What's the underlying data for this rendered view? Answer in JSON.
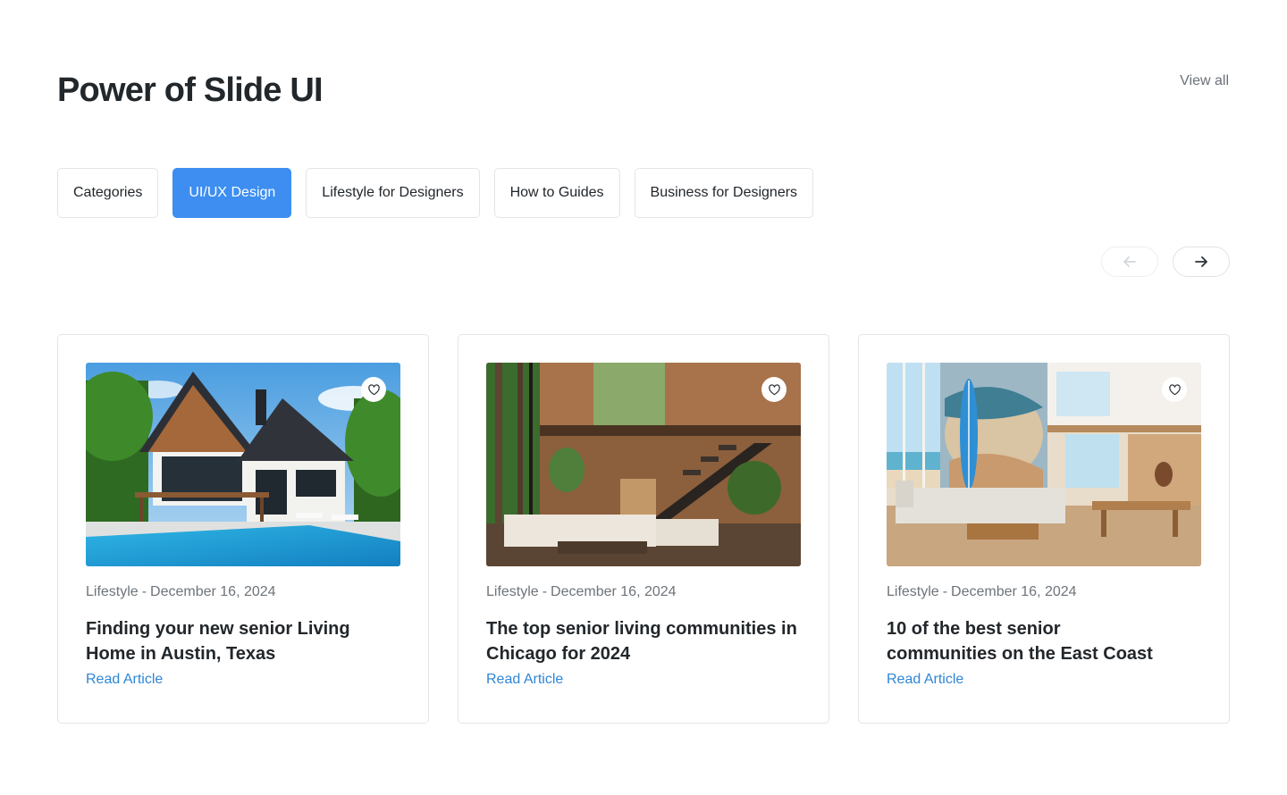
{
  "header": {
    "title": "Power of Slide UI",
    "view_all": "View all"
  },
  "tabs": [
    {
      "label": "Categories",
      "active": false
    },
    {
      "label": "UI/UX Design",
      "active": true
    },
    {
      "label": "Lifestyle for Designers",
      "active": false
    },
    {
      "label": "How to Guides",
      "active": false
    },
    {
      "label": "Business for Designers",
      "active": false
    }
  ],
  "carousel": {
    "prev_icon": "arrow-left-icon",
    "prev_disabled": true,
    "next_icon": "arrow-right-icon"
  },
  "cards": [
    {
      "image": "modern-house-with-pool",
      "category": "Lifestyle",
      "separator": "-",
      "date": "December 16, 2024",
      "title": "Finding your new senior Living Home in Austin, Texas",
      "link": "Read Article",
      "favorite_icon": "heart-icon"
    },
    {
      "image": "modern-living-room-with-staircase",
      "category": "Lifestyle",
      "separator": "-",
      "date": "December 16, 2024",
      "title": "The top senior living communities in Chicago for 2024",
      "link": "Read Article",
      "favorite_icon": "heart-icon"
    },
    {
      "image": "beach-house-living-room-with-surfboard",
      "category": "Lifestyle",
      "separator": "-",
      "date": "December 16, 2024",
      "title": "10 of the best senior communities on the East Coast",
      "link": "Read Article",
      "favorite_icon": "heart-icon"
    }
  ],
  "colors": {
    "accent": "#3d8ef0",
    "link": "#2f86d6",
    "border": "#e2e5e9",
    "muted_text": "#6e747a"
  }
}
